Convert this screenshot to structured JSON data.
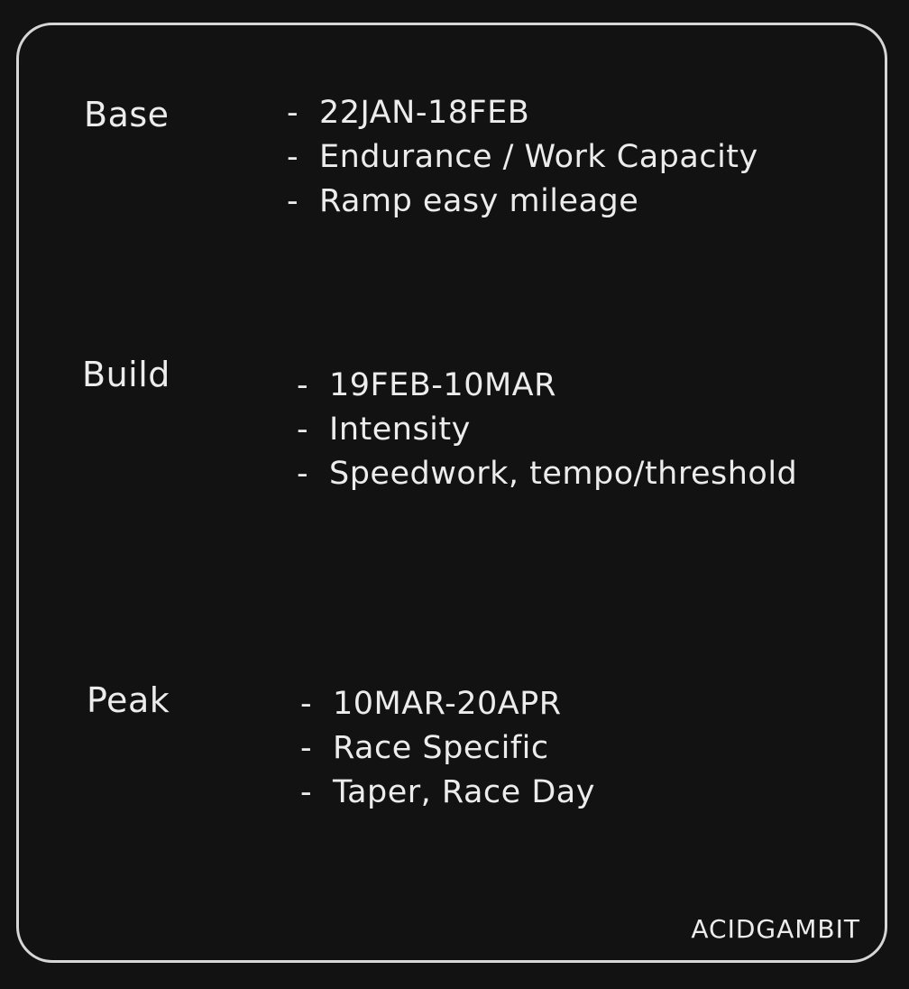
{
  "phases": [
    {
      "label": "Base",
      "bullets": [
        "22JAN-18FEB",
        "Endurance / Work Capacity",
        "Ramp easy mileage"
      ]
    },
    {
      "label": "Build",
      "bullets": [
        "19FEB-10MAR",
        "Intensity",
        "Speedwork, tempo/threshold"
      ]
    },
    {
      "label": "Peak",
      "bullets": [
        "10MAR-20APR",
        "Race Specific",
        "Taper, Race Day"
      ]
    }
  ],
  "bullet_marker": "-",
  "signature": "ACIDGAMBIT",
  "colors": {
    "background": "#121212",
    "text": "#ececec",
    "frame": "#d6d6d6"
  }
}
